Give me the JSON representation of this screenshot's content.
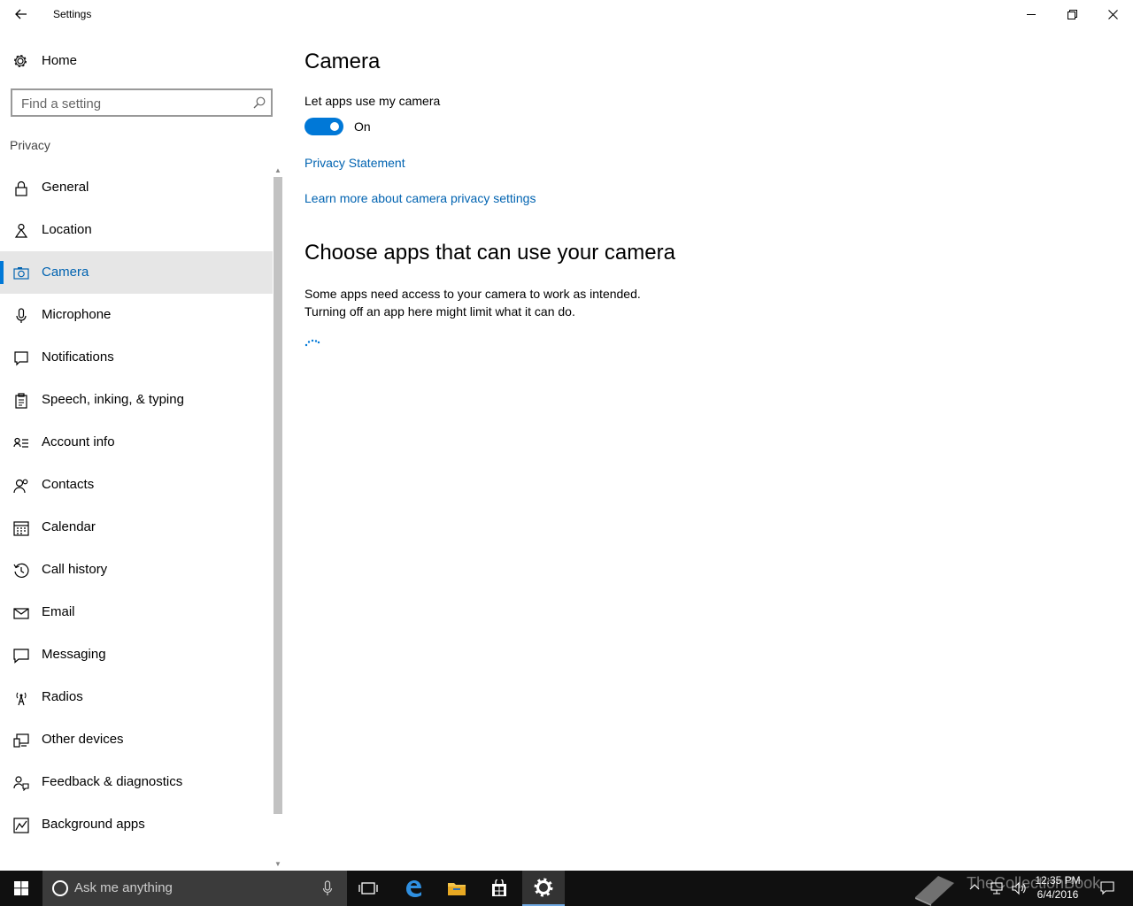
{
  "window": {
    "title": "Settings"
  },
  "sidebar": {
    "home_label": "Home",
    "search_placeholder": "Find a setting",
    "section": "Privacy",
    "items": [
      {
        "label": "General",
        "icon": "lock-icon"
      },
      {
        "label": "Location",
        "icon": "location-icon"
      },
      {
        "label": "Camera",
        "icon": "camera-icon",
        "selected": true
      },
      {
        "label": "Microphone",
        "icon": "microphone-icon"
      },
      {
        "label": "Notifications",
        "icon": "notifications-icon"
      },
      {
        "label": "Speech, inking, & typing",
        "icon": "speech-icon"
      },
      {
        "label": "Account info",
        "icon": "account-info-icon"
      },
      {
        "label": "Contacts",
        "icon": "contacts-icon"
      },
      {
        "label": "Calendar",
        "icon": "calendar-icon"
      },
      {
        "label": "Call history",
        "icon": "call-history-icon"
      },
      {
        "label": "Email",
        "icon": "email-icon"
      },
      {
        "label": "Messaging",
        "icon": "messaging-icon"
      },
      {
        "label": "Radios",
        "icon": "radios-icon"
      },
      {
        "label": "Other devices",
        "icon": "other-devices-icon"
      },
      {
        "label": "Feedback & diagnostics",
        "icon": "feedback-icon"
      },
      {
        "label": "Background apps",
        "icon": "background-apps-icon"
      }
    ]
  },
  "main": {
    "title": "Camera",
    "toggle_label": "Let apps use my camera",
    "toggle_state": "On",
    "toggle_on": true,
    "link_privacy": "Privacy Statement",
    "link_learn": "Learn more about camera privacy settings",
    "subheading": "Choose apps that can use your camera",
    "description_line1": "Some apps need access to your camera to work as intended.",
    "description_line2": "Turning off an app here might limit what it can do."
  },
  "taskbar": {
    "search_placeholder": "Ask me anything",
    "time": "12:35 PM",
    "date": "6/4/2016",
    "watermark": "TheCollectionBook"
  },
  "colors": {
    "accent": "#0078d7",
    "link": "#0063b1",
    "selected_bg": "#e6e6e6",
    "taskbar": "#101010"
  }
}
